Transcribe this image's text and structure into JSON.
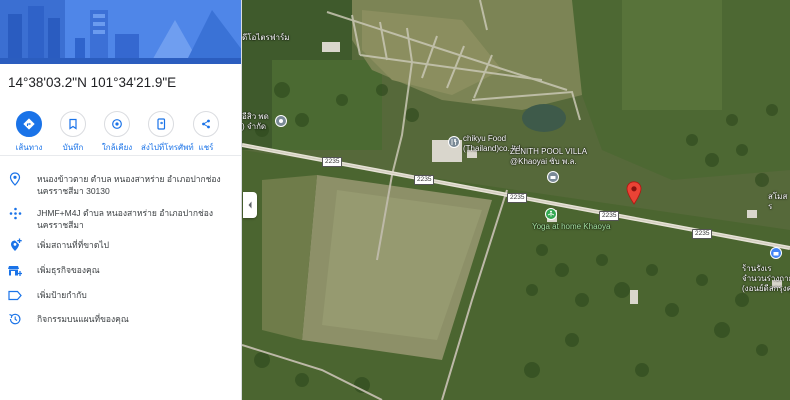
{
  "place": {
    "coordinates": "14°38'03.2\"N 101°34'21.9\"E"
  },
  "actions": [
    {
      "label": "เส้นทาง",
      "icon": "directions-icon"
    },
    {
      "label": "บันทึก",
      "icon": "bookmark-icon"
    },
    {
      "label": "ใกล้เคียง",
      "icon": "nearby-icon"
    },
    {
      "label": "ส่งไปที่โทรศัพท์",
      "icon": "send-to-phone-icon"
    },
    {
      "label": "แชร์",
      "icon": "share-icon"
    }
  ],
  "info": {
    "address": "หนองข้าวตาย ตำบล หนองสาหร่าย อำเภอปากช่อง นครราชสีมา 30130",
    "plus_code": "JHMF+M4J ตำบล หนองสาหร่าย อำเภอปากช่อง นครราชสีมา",
    "add_missing_place": "เพิ่มสถานที่ที่ขาดไป",
    "add_business": "เพิ่มธุรกิจของคุณ",
    "add_label": "เพิ่มป้ายกำกับ",
    "maps_activity": "กิจกรรมบนแผนที่ของคุณ"
  },
  "map": {
    "labels": {
      "farm_top": "ดีโอไตรฟาร์ม",
      "left_poi_line1": "อีสิว พด",
      "left_poi_line2": ") จำกัด",
      "food_line1": "chikyu Food",
      "food_line2": "(Thailand)co.,ltd",
      "pool_line1": "ZENITH POOL VILLA",
      "pool_line2": "@Khaoyai ซับ พ.ล.",
      "yoga": "Yoga at home Khaoya",
      "right_top_line1": "สโมส",
      "right_top_line2": "ร",
      "right_bottom_line1": "ร้านรังเร",
      "right_bottom_line2": "จำนวนร่างกาย",
      "right_bottom_line3": "(งอนย์ดีลกรุงคุณ"
    },
    "road_number": "2235",
    "colors": {
      "pin": "#ea4335",
      "poi_gray": "#7a8a96",
      "poi_green": "#34a853",
      "poi_blue": "#4285f4"
    }
  }
}
